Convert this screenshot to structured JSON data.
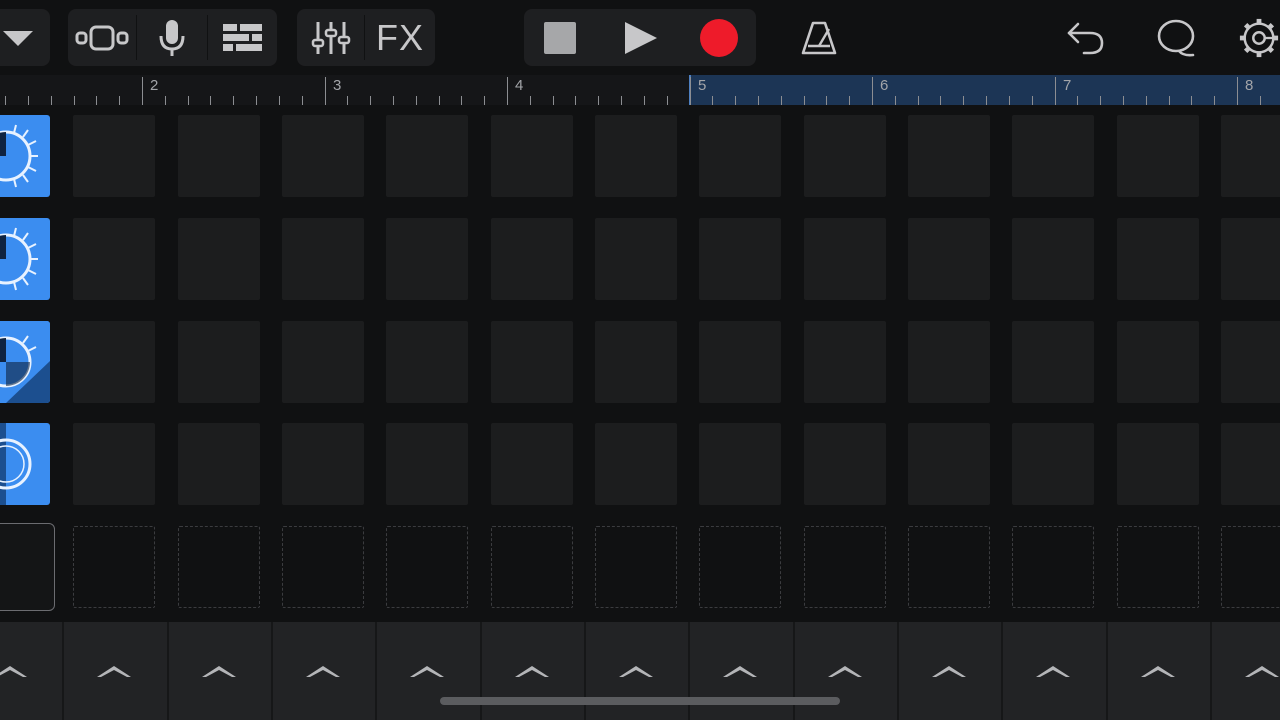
{
  "toolbar": {
    "left": [
      {
        "name": "track-menu-dropdown-icon",
        "icon": "chevron-down"
      },
      {
        "name": "view-toggle-icon",
        "icon": "tracks-view"
      },
      {
        "name": "microphone-icon",
        "icon": "microphone"
      },
      {
        "name": "track-list-icon",
        "icon": "track-list"
      }
    ],
    "mixer_icon": "sliders",
    "fx_label": "FX",
    "transport": [
      {
        "name": "stop-button",
        "icon": "stop"
      },
      {
        "name": "play-button",
        "icon": "play"
      },
      {
        "name": "record-button",
        "icon": "record",
        "color": "#ee1b2a"
      }
    ],
    "metronome_icon": "metronome",
    "right": [
      {
        "name": "undo-button",
        "icon": "undo"
      },
      {
        "name": "loop-browser-button",
        "icon": "loop"
      },
      {
        "name": "settings-button",
        "icon": "gear"
      }
    ]
  },
  "ruler": {
    "bar_numbers": [
      "2",
      "3",
      "4",
      "5",
      "6",
      "7",
      "8"
    ],
    "loop_region_color": "#1c3555"
  },
  "grid": {
    "rows": 5,
    "columns": 12,
    "track_icons": [
      {
        "name": "track-1-icon",
        "icon": "live-loop-circle",
        "color": "#3b8df0"
      },
      {
        "name": "track-2-icon",
        "icon": "live-loop-circle",
        "color": "#3b8df0"
      },
      {
        "name": "track-3-icon",
        "icon": "live-loop-circle-dark",
        "color": "#3b8df0"
      },
      {
        "name": "track-4-icon",
        "icon": "live-loop-circle-ring",
        "color": "#3b8df0"
      },
      {
        "name": "track-5-icon",
        "icon": "empty-track",
        "color": "#141516"
      }
    ]
  },
  "triggers": {
    "count": 13,
    "icon": "chevron-up"
  }
}
